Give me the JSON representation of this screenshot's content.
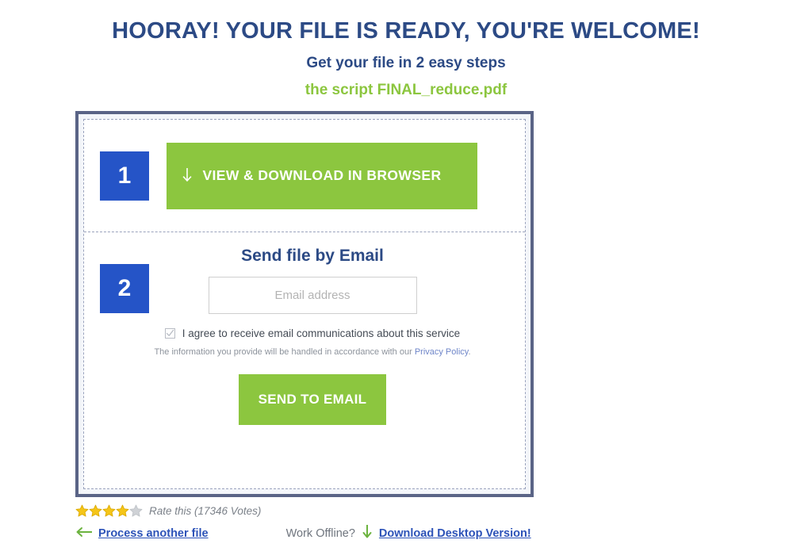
{
  "header": {
    "headline": "HOORAY! YOUR FILE IS READY, YOU'RE WELCOME!",
    "subhead": "Get your file in 2 easy steps",
    "filename": "the script FINAL_reduce.pdf"
  },
  "card": {
    "step1": {
      "badge": "1",
      "download_button_label": "VIEW & DOWNLOAD IN BROWSER",
      "download_icon": "arrow-down-icon"
    },
    "step2": {
      "badge": "2",
      "title": "Send file by Email",
      "email_placeholder": "Email address",
      "email_value": "",
      "agree_label": "I agree to receive email communications about this service",
      "agree_checked": true,
      "privacy_prefix": "The information you provide will be handled in accordance with our ",
      "privacy_link": "Privacy Policy",
      "privacy_suffix": ".",
      "send_button_label": "SEND TO EMAIL"
    }
  },
  "footer": {
    "rating": {
      "filled_stars": 4,
      "total_stars": 5,
      "rate_text": "Rate this (17346 Votes)"
    },
    "process_another_label": "Process another file",
    "process_another_icon": "arrow-left-icon",
    "work_offline_label": "Work Offline?",
    "desktop_icon": "arrow-down-icon",
    "desktop_link_label": "Download Desktop Version!"
  },
  "colors": {
    "navy": "#2c4a85",
    "green": "#8cc63f",
    "blue_badge": "#2554c7",
    "link_blue": "#2d53b8",
    "star_gold": "#f5c518",
    "star_empty": "#cfd2d6",
    "card_border": "#5a6486"
  }
}
